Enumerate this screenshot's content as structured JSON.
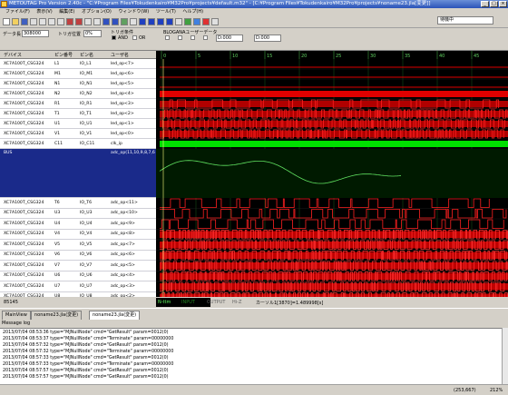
{
  "window": {
    "title": "METOUTAG Pro Version 2.40c - \"C:¥Program Files¥Tokudenkairo¥M32Pro¥projects¥default.m32\" - [C:¥Program Files¥Tokudenkairo¥M32Pro¥projects¥noname23.jla[変更]]"
  },
  "menu": [
    "ファイル(F)",
    "表示(V)",
    "編集(E)",
    "オプション(O)",
    "ウィンドウ(W)",
    "ツール(T)",
    "ヘルプ(H)"
  ],
  "status_box": "待機中",
  "options": {
    "data_count_label": "データ長",
    "data_count_value": "308000",
    "trigger_pos_label": "トリガ位置",
    "trigger_pos_value": "0%",
    "trigger_cond_label": "トリガ条件",
    "and_label": "AND",
    "or_label": "OR",
    "blogana_label": "BLOGANAユーザーデータ",
    "field1": "D:000",
    "field2": "D:000"
  },
  "columns": {
    "device": "デバイス",
    "pin_no": "ピン番号",
    "pin_name": "ピン名",
    "user_name": "ユーザ名"
  },
  "ruler_ticks": [
    "0",
    "5",
    "10",
    "15",
    "20",
    "25",
    "30",
    "35",
    "40",
    "45"
  ],
  "signals_top": [
    {
      "device": "XC7A100T_CSG324",
      "pin": "L1",
      "pname": "IO_L1",
      "user": "led_op<7>"
    },
    {
      "device": "XC7A100T_CSG324",
      "pin": "M1",
      "pname": "IO_M1",
      "user": "led_op<6>"
    },
    {
      "device": "XC7A100T_CSG324",
      "pin": "N1",
      "pname": "IO_N1",
      "user": "led_op<5>"
    },
    {
      "device": "XC7A100T_CSG324",
      "pin": "N2",
      "pname": "IO_N2",
      "user": "led_op<4>"
    },
    {
      "device": "XC7A100T_CSG324",
      "pin": "R1",
      "pname": "IO_R1",
      "user": "led_op<3>"
    },
    {
      "device": "XC7A100T_CSG324",
      "pin": "T1",
      "pname": "IO_T1",
      "user": "led_op<2>"
    },
    {
      "device": "XC7A100T_CSG324",
      "pin": "U1",
      "pname": "IO_U1",
      "user": "led_op<1>"
    },
    {
      "device": "XC7A100T_CSG324",
      "pin": "V1",
      "pname": "IO_V1",
      "user": "led_op<0>"
    },
    {
      "device": "XC7A100T_CSG324",
      "pin": "C11",
      "pname": "IO_C11",
      "user": "clk_ip"
    }
  ],
  "bus": {
    "name": "BUS",
    "user": "adc_op(11,10,9,8,7,6"
  },
  "signals_bottom": [
    {
      "device": "XC7A100T_CSG324",
      "pin": "T6",
      "pname": "IO_T6",
      "user": "adc_op<11>"
    },
    {
      "device": "XC7A100T_CSG324",
      "pin": "U3",
      "pname": "IO_U3",
      "user": "adc_op<10>"
    },
    {
      "device": "XC7A100T_CSG324",
      "pin": "U4",
      "pname": "IO_U4",
      "user": "adc_op<9>"
    },
    {
      "device": "XC7A100T_CSG324",
      "pin": "V4",
      "pname": "IO_V4",
      "user": "adc_op<8>"
    },
    {
      "device": "XC7A100T_CSG324",
      "pin": "V5",
      "pname": "IO_V5",
      "user": "adc_op<7>"
    },
    {
      "device": "XC7A100T_CSG324",
      "pin": "V6",
      "pname": "IO_V6",
      "user": "adc_op<6>"
    },
    {
      "device": "XC7A100T_CSG324",
      "pin": "V7",
      "pname": "IO_V7",
      "user": "adc_op<5>"
    },
    {
      "device": "XC7A100T_CSG324",
      "pin": "U6",
      "pname": "IO_U6",
      "user": "adc_op<4>"
    },
    {
      "device": "XC7A100T_CSG324",
      "pin": "U7",
      "pname": "IO_U7",
      "user": "adc_op<3>"
    },
    {
      "device": "XC7A100T_CSG324",
      "pin": "U8",
      "pname": "IO_U8",
      "user": "adc_op<2>"
    },
    {
      "device": "XC7A100T_CSG324",
      "pin": "U9",
      "pname": "IO_U9",
      "user": "adc_op<1>"
    }
  ],
  "bottom_bar": {
    "count": "85145",
    "legend": [
      "N-ttm",
      "INPUT",
      "OUTPUT",
      "Hi-Z"
    ],
    "cursor_text": "カーソル1[3870]=1.489998[s]"
  },
  "tabs": [
    "MainView",
    "noname23.jla(変更)",
    "noname23.jla(変更)"
  ],
  "message_log_title": "Message log",
  "messages": [
    "2013/07/04 08:53:36  type=\"MJNullNode\"  cmd=\"GetResult\"  param=0012(0)",
    "2013/07/04 08:53:37  type=\"MJNullNode\"  cmd=\"Terminate\"  param=00000000",
    "2013/07/04 08:57:32  type=\"MJNullNode\"  cmd=\"GetResult\"  param=0012(0)",
    "2013/07/04 08:57:32  type=\"MJNullNode\"  cmd=\"Terminate\"  param=00000000",
    "2013/07/04 08:57:33  type=\"MJNullNode\"  cmd=\"GetResult\"  param=0012(0)",
    "2013/07/04 08:57:33  type=\"MJNullNode\"  cmd=\"Terminate\"  param=00000000",
    "2013/07/04 08:57:57  type=\"MJNullNode\"  cmd=\"GetResult\"  param=0012(0)",
    "2013/07/04 08:57:57  type=\"MJNullNode\"  cmd=\"GetResult\"  param=0012(0)"
  ],
  "status_bar": {
    "coords": "(253,667)",
    "zoom": "212%"
  }
}
